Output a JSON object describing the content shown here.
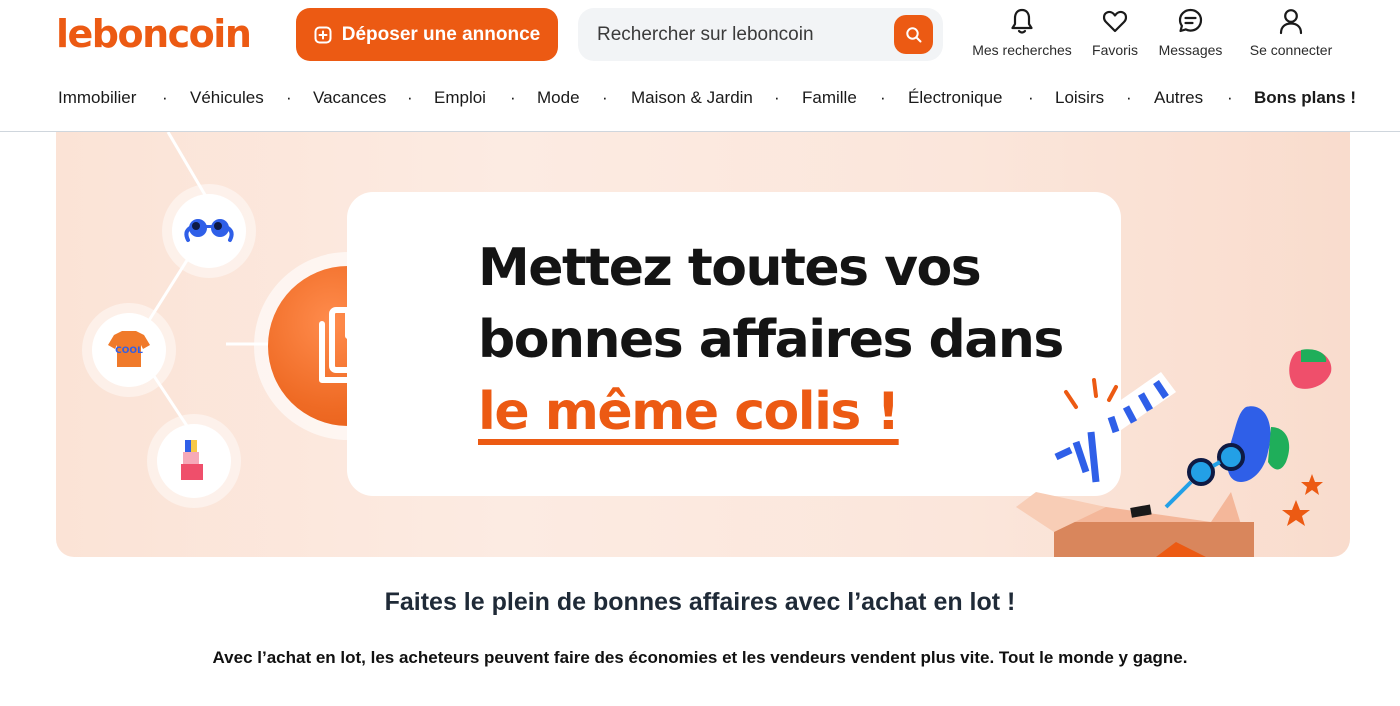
{
  "brand": {
    "logo_text": "leboncoin",
    "accent_color": "#ec5a13"
  },
  "header": {
    "post_button_label": "Déposer une annonce",
    "search_placeholder": "Rechercher sur leboncoin",
    "actions": [
      {
        "label": "Mes recherches",
        "icon": "bell-icon"
      },
      {
        "label": "Favoris",
        "icon": "heart-icon"
      },
      {
        "label": "Messages",
        "icon": "chat-icon"
      },
      {
        "label": "Se connecter",
        "icon": "user-icon"
      }
    ]
  },
  "categories": [
    "Immobilier",
    "Véhicules",
    "Vacances",
    "Emploi",
    "Mode",
    "Maison & Jardin",
    "Famille",
    "Électronique",
    "Loisirs",
    "Autres",
    "Bons plans !"
  ],
  "banner": {
    "line1": "Mettez toutes vos",
    "line2": "bonnes affaires dans",
    "line3": "le même colis !",
    "tshirt_text": "COOL"
  },
  "content": {
    "title": "Faites le plein de bonnes affaires avec l’achat en lot !",
    "text": "Avec l’achat en lot, les acheteurs peuvent faire des économies et les vendeurs vendent plus vite. Tout le monde y gagne."
  }
}
